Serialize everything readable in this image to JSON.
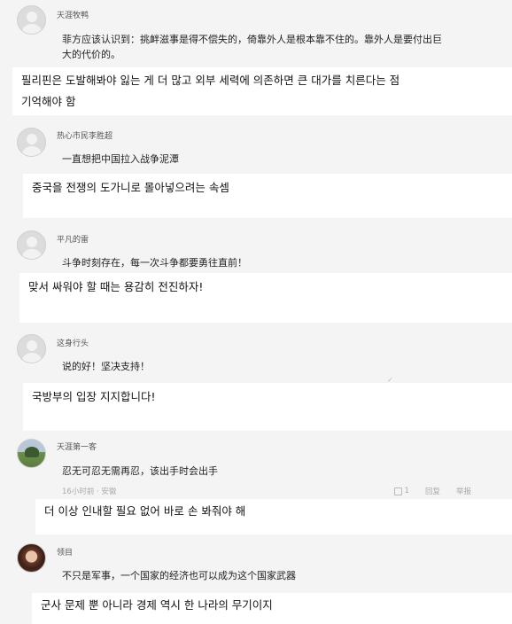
{
  "comments": [
    {
      "username": "天涯牧鸭",
      "text_zh": "菲方应该认识到：挑衅滋事是得不偿失的，倚靠外人是根本靠不住的。靠外人是要付出巨大的代价的。",
      "text_zh_line1": "菲方应该认识到：挑衅滋事是得不偿失的，倚靠外人是根本靠不住的。靠外人是要付出巨",
      "text_zh_line2": "大的代价的。",
      "translation_line1": "필리핀은 도발해봐야 잃는 게 더 많고 외부 세력에 의존하면 큰 대가를 치른다는 점",
      "translation_line2": "기억해야 함"
    },
    {
      "username": "热心市民李胜超",
      "text_zh": "一直想把中国拉入战争泥潭",
      "translation": "중국을 전쟁의 도가니로 몰아넣으려는 속셈"
    },
    {
      "username": "平凡的雷",
      "text_zh": "斗争时刻存在，每一次斗争都要勇往直前！",
      "translation": "맞서 싸워야 할 때는 용감히 전진하자!"
    },
    {
      "username": "这身行头",
      "text_zh": "说的好！坚决支持！",
      "translation": "국방부의 입장 지지합니다!"
    },
    {
      "username": "天涯第一客",
      "text_zh": "忍无可忍无需再忍，该出手时会出手",
      "meta": "16小时前 · 安徽",
      "like_count": "1",
      "reply_label": "回复",
      "report_label": "举报",
      "translation": "더 이상 인내할 필요 없어 바로 손 봐줘야 해"
    },
    {
      "username": "领目",
      "text_zh": "不只是军事，一个国家的经济也可以成为这个国家武器",
      "translation": "군사 문제 뿐 아니라 경제 역시 한 나라의 무기이지"
    }
  ]
}
